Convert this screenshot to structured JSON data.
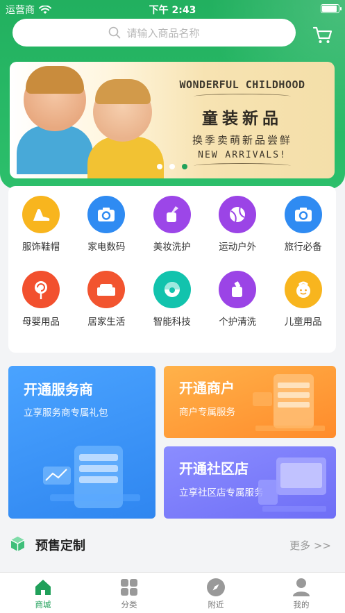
{
  "status": {
    "carrier": "运营商",
    "time": "下午 2:43",
    "battery_level": 0.8
  },
  "search": {
    "placeholder": "请输入商品名称"
  },
  "banner": {
    "line1": "WONDERFUL CHILDHOOD",
    "line2": "童装新品",
    "line3": "换季卖萌新品尝鲜",
    "line4": "NEW ARRIVALS!",
    "active_dot": 3,
    "dot_count": 3
  },
  "categories": [
    {
      "label": "服饰鞋帽",
      "icon": "high-heel-icon",
      "color": "#f8b51e"
    },
    {
      "label": "家电数码",
      "icon": "camera-icon",
      "color": "#2f8bf2"
    },
    {
      "label": "美妆洗护",
      "icon": "cosmetics-icon",
      "color": "#9c46e8"
    },
    {
      "label": "运动户外",
      "icon": "ball-icon",
      "color": "#9b44e6"
    },
    {
      "label": "旅行必备",
      "icon": "camera-icon",
      "color": "#2f8bf2"
    },
    {
      "label": "母婴用品",
      "icon": "lollipop-icon",
      "color": "#f2502e"
    },
    {
      "label": "居家生活",
      "icon": "sofa-icon",
      "color": "#f2542f"
    },
    {
      "label": "智能科技",
      "icon": "robot-icon",
      "color": "#12c3ad"
    },
    {
      "label": "个护清洗",
      "icon": "bottle-icon",
      "color": "#9b44e6"
    },
    {
      "label": "儿童用品",
      "icon": "baby-face-icon",
      "color": "#f8b51e"
    }
  ],
  "promos": {
    "service": {
      "title": "开通服务商",
      "sub": "立享服务商专属礼包"
    },
    "merchant": {
      "title": "开通商户",
      "sub": "商户专属服务"
    },
    "community": {
      "title": "开通社区店",
      "sub": "立享社区店专属服务"
    }
  },
  "presale": {
    "title": "预售定制",
    "more": "更多 >>"
  },
  "tabs": [
    {
      "label": "商城",
      "icon": "home-icon",
      "active": true
    },
    {
      "label": "分类",
      "icon": "grid-icon",
      "active": false
    },
    {
      "label": "附近",
      "icon": "compass-icon",
      "active": false
    },
    {
      "label": "我的",
      "icon": "user-icon",
      "active": false
    }
  ],
  "colors": {
    "brand": "#22b05f",
    "active_tab": "#20a05a"
  }
}
